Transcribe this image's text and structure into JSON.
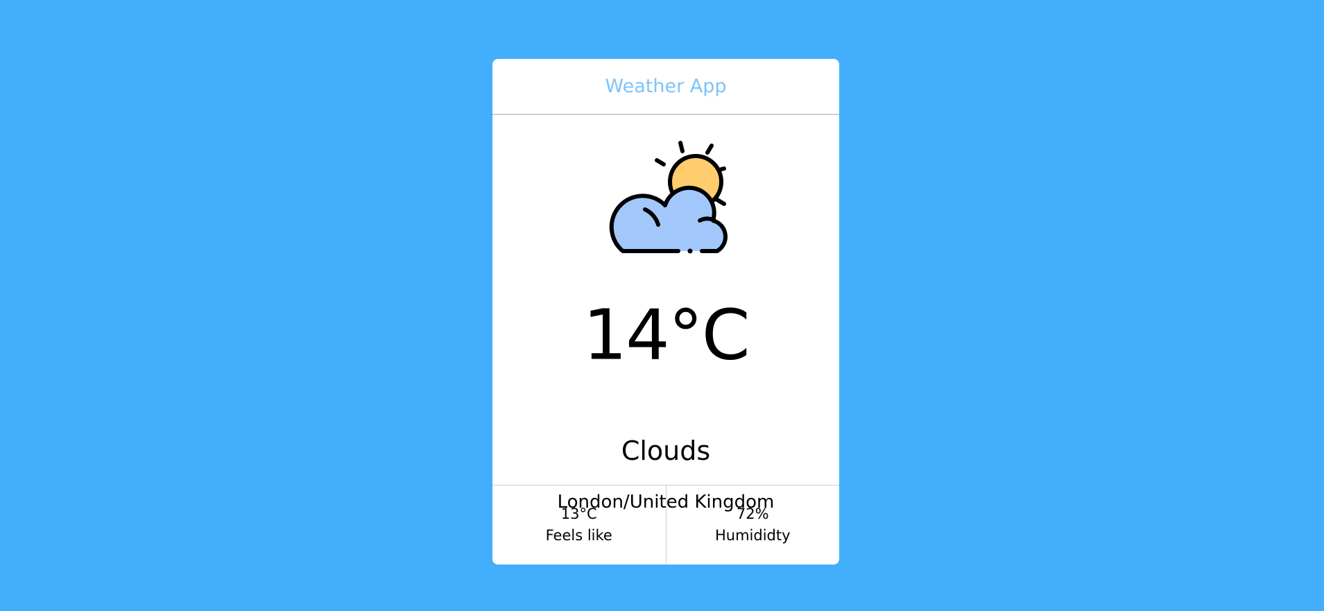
{
  "header": {
    "title": "Weather App",
    "title_color": "#7cc4fb"
  },
  "weather": {
    "icon": "partly-cloudy-icon",
    "temperature": "14°C",
    "condition": "Clouds",
    "location": "London/United Kingdom"
  },
  "stats": {
    "feels_like": {
      "value": "13°C",
      "label": "Feels like"
    },
    "humidity": {
      "value": "72%",
      "label": "Humididty"
    }
  },
  "colors": {
    "background": "#43aefc",
    "card": "#ffffff",
    "sun": "#ffcc6e",
    "cloud": "#a2c8fb"
  }
}
